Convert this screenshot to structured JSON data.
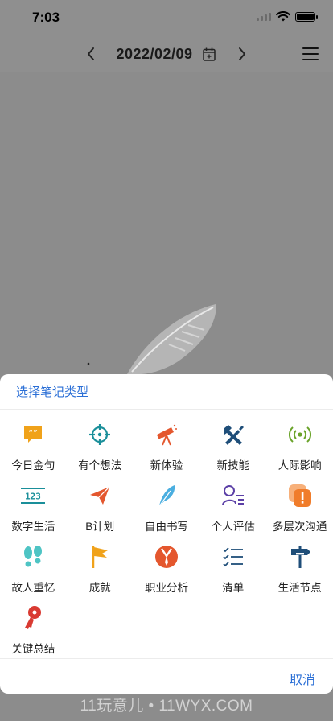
{
  "status_bar": {
    "time": "7:03"
  },
  "nav": {
    "date": "2022/02/09"
  },
  "sheet": {
    "title": "选择笔记类型",
    "cancel_label": "取消",
    "items": [
      {
        "label": "今日金句",
        "icon": "quote-icon",
        "color": "#f0a21a"
      },
      {
        "label": "有个想法",
        "icon": "target-icon",
        "color": "#1a8f9a"
      },
      {
        "label": "新体验",
        "icon": "telescope-icon",
        "color": "#e4572e"
      },
      {
        "label": "新技能",
        "icon": "tools-icon",
        "color": "#1f4e79"
      },
      {
        "label": "人际影响",
        "icon": "broadcast-icon",
        "color": "#6aa32a"
      },
      {
        "label": "数字生活",
        "icon": "digits-icon",
        "color": "#1a8f9a"
      },
      {
        "label": "B计划",
        "icon": "paper-plane-icon",
        "color": "#e4572e"
      },
      {
        "label": "自由书写",
        "icon": "feather-icon",
        "color": "#4aaee0"
      },
      {
        "label": "个人评估",
        "icon": "user-list-icon",
        "color": "#5b3fa6"
      },
      {
        "label": "多层次沟通",
        "icon": "chat-alert-icon",
        "color": "#f07c2a"
      },
      {
        "label": "故人重忆",
        "icon": "footprints-icon",
        "color": "#4ec4c4"
      },
      {
        "label": "成就",
        "icon": "flag-icon",
        "color": "#f0a21a"
      },
      {
        "label": "职业分析",
        "icon": "suit-icon",
        "color": "#e4572e"
      },
      {
        "label": "清单",
        "icon": "checklist-icon",
        "color": "#1f4e79"
      },
      {
        "label": "生活节点",
        "icon": "signpost-icon",
        "color": "#1f4e79"
      },
      {
        "label": "关键总结",
        "icon": "key-icon",
        "color": "#d93a32"
      }
    ]
  },
  "watermark": "11玩意儿 • 11WYX.COM"
}
